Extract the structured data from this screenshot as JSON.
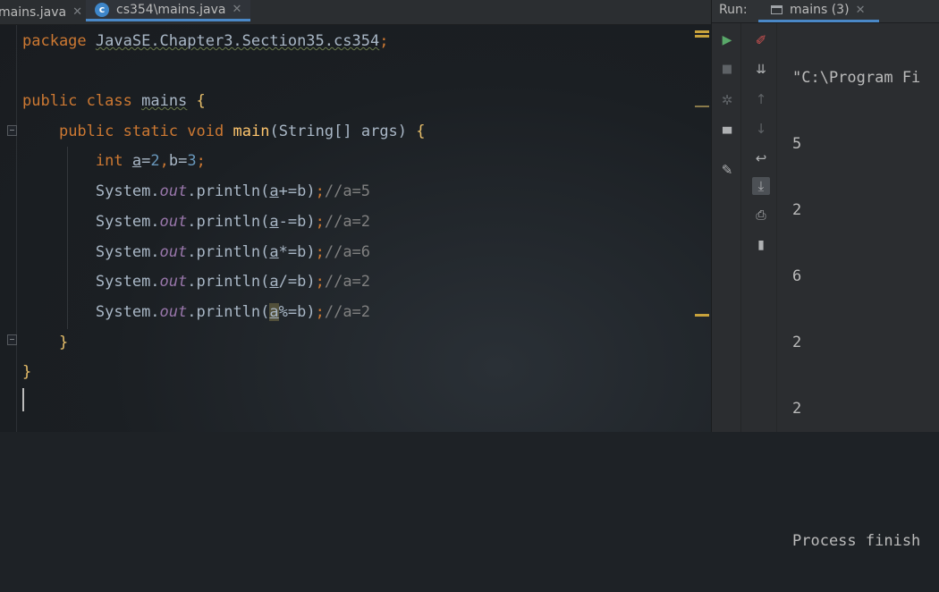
{
  "editor_tabs": [
    {
      "label": "mains.java",
      "active": false
    },
    {
      "label": "cs354\\mains.java",
      "active": true
    }
  ],
  "code": {
    "package_kw": "package",
    "package_name": "JavaSE.Chapter3.Section35.cs354",
    "class_decl": {
      "kw1": "public",
      "kw2": "class",
      "name": "mains",
      "open": "{"
    },
    "main_decl": {
      "kw1": "public",
      "kw2": "static",
      "kw3": "void",
      "name": "main",
      "params_open": "(",
      "param_type": "String[]",
      "param_name": "args",
      "params_close": ")",
      "open": "{"
    },
    "int_decl": {
      "kw": "int",
      "var_a": "a",
      "eq_a": "=",
      "val_a": "2",
      "comma": ",",
      "var_b": "b=",
      "val_b": "3",
      "semi": ";"
    },
    "prints": [
      {
        "obj": "System.",
        "field": "out",
        "method": ".println(",
        "var": "a",
        "op": "+=b)",
        "semi": ";",
        "comment": "//a=5"
      },
      {
        "obj": "System.",
        "field": "out",
        "method": ".println(",
        "var": "a",
        "op": "-=b)",
        "semi": ";",
        "comment": "//a=2"
      },
      {
        "obj": "System.",
        "field": "out",
        "method": ".println(",
        "var": "a",
        "op": "*=b)",
        "semi": ";",
        "comment": "//a=6"
      },
      {
        "obj": "System.",
        "field": "out",
        "method": ".println(",
        "var": "a",
        "op": "/=b)",
        "semi": ";",
        "comment": "//a=2"
      },
      {
        "obj": "System.",
        "field": "out",
        "method": ".println(",
        "var": "a",
        "op": "%=b)",
        "semi": ";",
        "comment": "//a=2"
      }
    ],
    "close_main": "}",
    "close_class": "}"
  },
  "run_panel": {
    "label": "Run:",
    "tab_label": "mains (3)",
    "output": [
      "\"C:\\Program Fi",
      "5",
      "2",
      "6",
      "2",
      "2",
      "",
      "Process finish"
    ]
  },
  "toolbar_icons": [
    "run-icon",
    "stop-icon",
    "debug-icon",
    "layout-icon",
    "pin-icon",
    "edit-config-icon",
    "sort-icon",
    "up-arrow-icon",
    "down-arrow-icon",
    "soft-wrap-icon",
    "scroll-to-end-icon",
    "print-icon",
    "trash-icon"
  ],
  "colors": {
    "keyword": "#cc7832",
    "method": "#ffc66d",
    "number": "#6897bb",
    "field": "#9876aa",
    "comment": "#808080",
    "accent": "#4a88c7"
  }
}
